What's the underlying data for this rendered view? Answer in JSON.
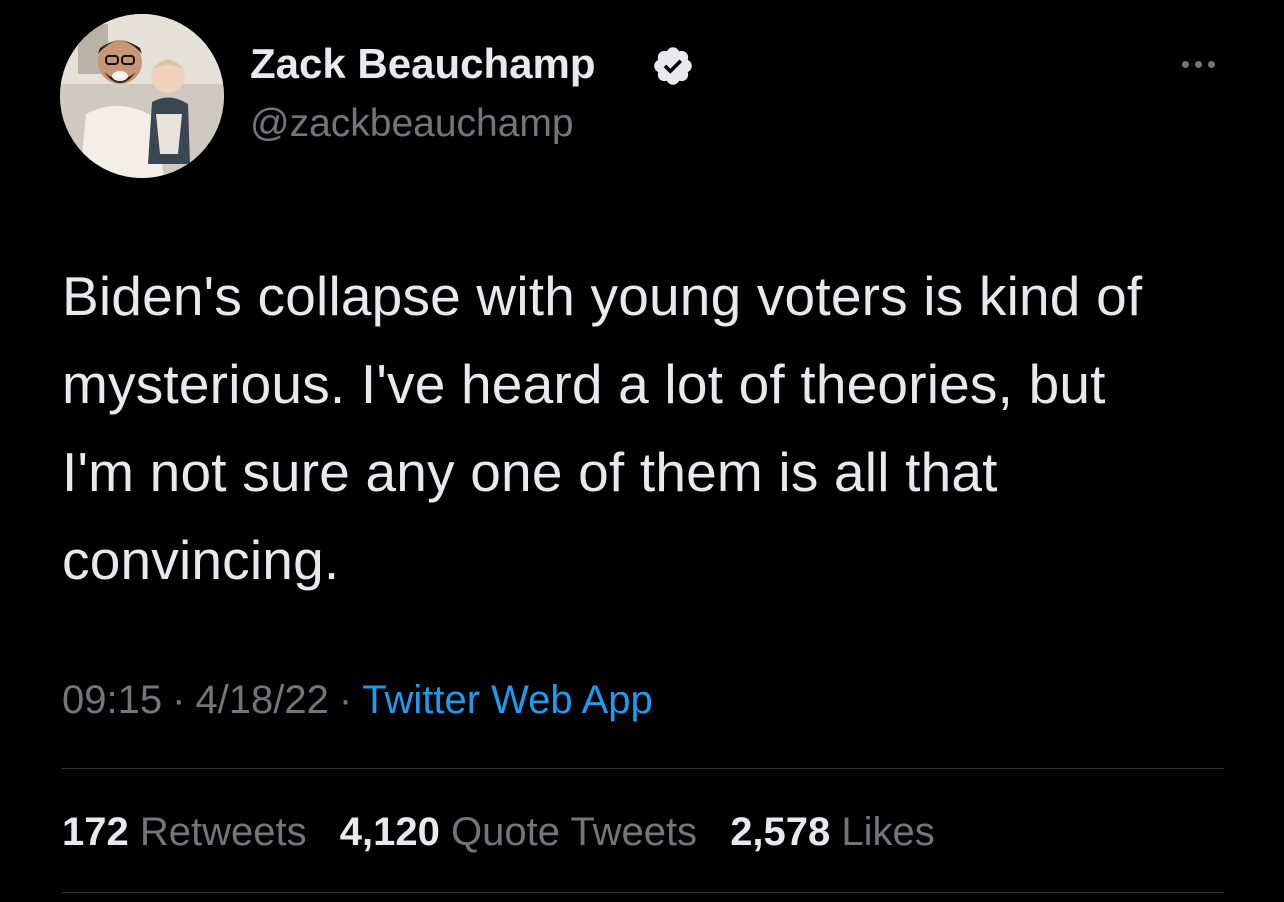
{
  "author": {
    "name": "Zack Beauchamp",
    "handle": "@zackbeauchamp",
    "verified": true,
    "avatar_icon": "profile-photo"
  },
  "tweet": {
    "text": "Biden's collapse with young voters is kind of mysterious. I've heard a lot of theories, but I'm not sure any one of them is all that convincing."
  },
  "meta": {
    "time": "09:15",
    "separator": "·",
    "date": "4/18/22",
    "source": "Twitter Web App"
  },
  "stats": {
    "retweets_count": "172",
    "retweets_label": "Retweets",
    "quotes_count": "4,120",
    "quotes_label": "Quote Tweets",
    "likes_count": "2,578",
    "likes_label": "Likes"
  },
  "colors": {
    "background": "#000000",
    "text_primary": "#e7e9ea",
    "text_secondary": "#71767b",
    "link": "#1d9bf0",
    "divider": "#2f3336"
  }
}
